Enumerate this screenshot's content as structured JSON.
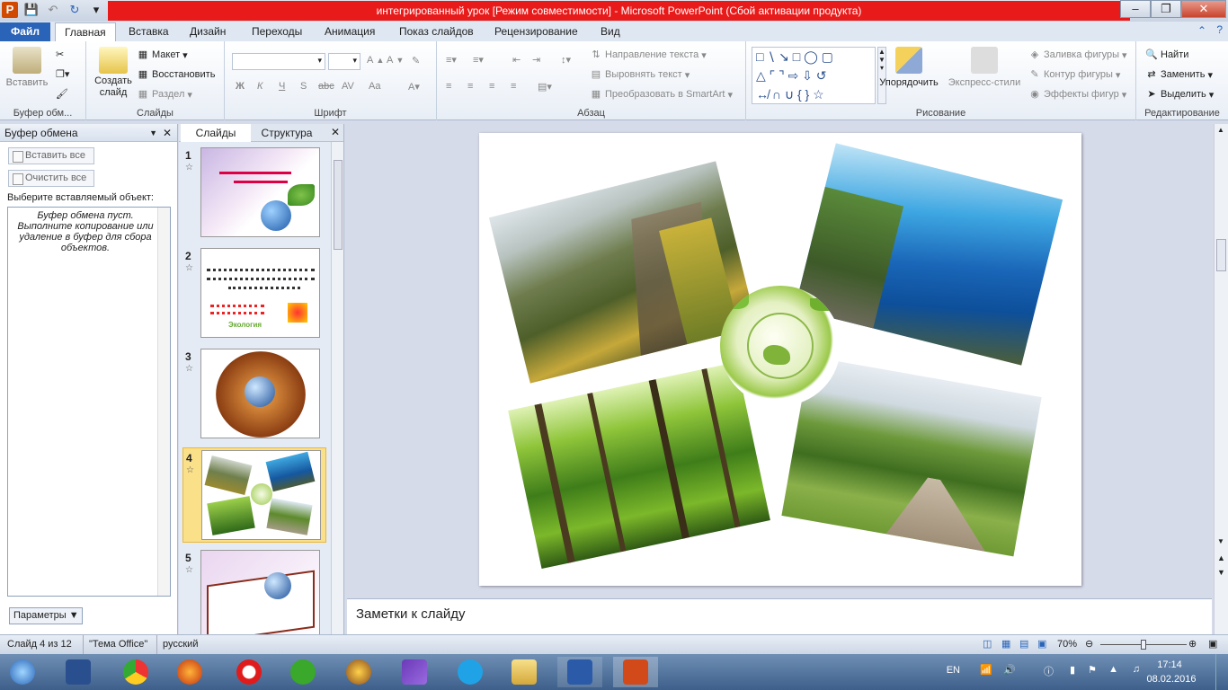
{
  "window": {
    "title": "интегрированный урок [Режим совместимости] - Microsoft PowerPoint (Сбой активации продукта)",
    "app_icon": "P"
  },
  "tabs": [
    {
      "label": "Файл"
    },
    {
      "label": "Главная"
    },
    {
      "label": "Вставка"
    },
    {
      "label": "Дизайн"
    },
    {
      "label": "Переходы"
    },
    {
      "label": "Анимация"
    },
    {
      "label": "Показ слайдов"
    },
    {
      "label": "Рецензирование"
    },
    {
      "label": "Вид"
    }
  ],
  "ribbon": {
    "clipboard": {
      "paste": "Вставить",
      "group": "Буфер обм..."
    },
    "slides": {
      "new_slide": "Создать",
      "new_slide2": "слайд",
      "layout": "Макет",
      "reset": "Восстановить",
      "section": "Раздел",
      "group": "Слайды"
    },
    "font": {
      "group": "Шрифт",
      "bold": "Ж",
      "italic": "К",
      "underline": "Ч",
      "shadow": "S",
      "strike": "abc",
      "spacing": "AV",
      "case": "Aa"
    },
    "paragraph": {
      "text_direction": "Направление текста",
      "align_text": "Выровнять текст",
      "smartart": "Преобразовать в SmartArt",
      "group": "Абзац"
    },
    "drawing": {
      "arrange": "Упорядочить",
      "quick_styles": "Экспресс-стили",
      "fill": "Заливка фигуры",
      "outline": "Контур фигуры",
      "effects": "Эффекты фигур",
      "group": "Рисование"
    },
    "editing": {
      "find": "Найти",
      "replace": "Заменить",
      "select": "Выделить",
      "group": "Редактирование"
    }
  },
  "clipboard_pane": {
    "title": "Буфер обмена",
    "paste_all": "Вставить все",
    "clear_all": "Очистить все",
    "choose_label": "Выберите вставляемый объект:",
    "empty_message": "Буфер обмена пуст. Выполните копирование или удаление в буфер для сбора объектов.",
    "options": "Параметры"
  },
  "slides_pane": {
    "tab_slides": "Слайды",
    "tab_outline": "Структура",
    "thumbnails": [
      {
        "num": "1"
      },
      {
        "num": "2"
      },
      {
        "num": "3"
      },
      {
        "num": "4",
        "selected": true
      },
      {
        "num": "5"
      }
    ],
    "thumb2_text": "Экология"
  },
  "notes": {
    "placeholder": "Заметки к слайду"
  },
  "status": {
    "slide_of": "Слайд 4 из 12",
    "theme": "\"Тема Office\"",
    "language": "русский",
    "zoom": "70%",
    "zoom_fraction": 0.5
  },
  "taskbar": {
    "lang": "EN",
    "time": "17:14",
    "date": "08.02.2016"
  },
  "colors": {
    "accent": "#2a64b8",
    "title_red": "#e81a1a",
    "selection": "#fbe08a"
  }
}
